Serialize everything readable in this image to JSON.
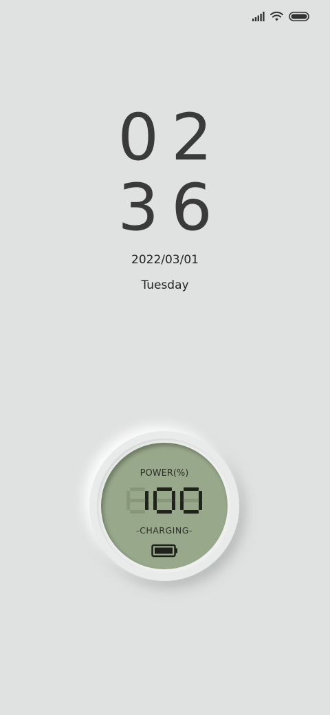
{
  "status_bar": {
    "icons": [
      "signal-icon",
      "wifi-icon",
      "battery-status-icon"
    ]
  },
  "clock": {
    "hours": "02",
    "minutes": "36"
  },
  "date": "2022/03/01",
  "weekday": "Tuesday",
  "power_widget": {
    "label": "POWER(%)",
    "value": "100",
    "status": "-CHARGING-",
    "icon": "battery-icon",
    "screen_color": "#98a88a"
  }
}
